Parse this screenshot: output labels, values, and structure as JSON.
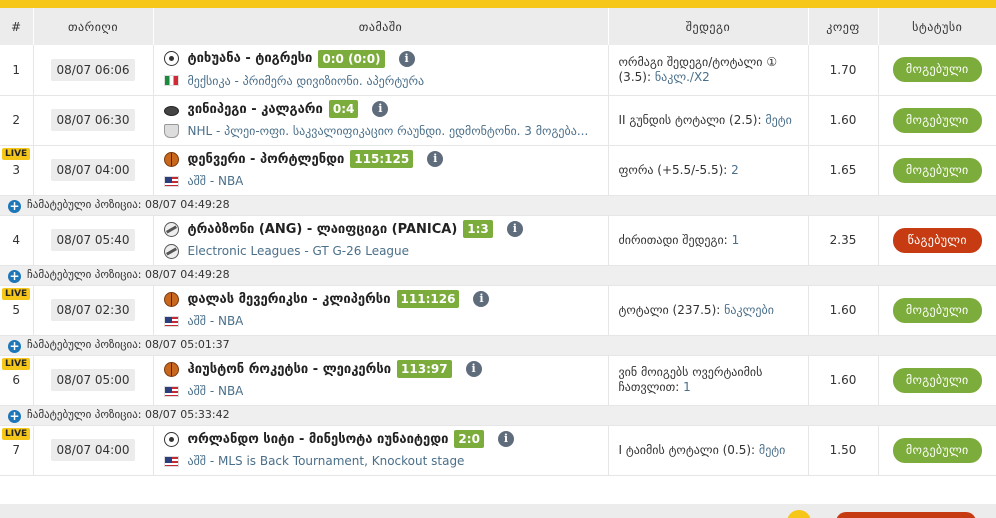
{
  "header": {
    "num": "#",
    "date": "თარიღი",
    "match": "თამაში",
    "result": "შედეგი",
    "odds": "კოეფ",
    "status": "სტატუსი"
  },
  "cashout_label": "ჩამატებული პოზიცია:",
  "colors": {
    "accent_yellow": "#f6c619",
    "won_green": "#7cac3b",
    "lost_red": "#c73b12",
    "league_blue": "#4a6f8a",
    "plus_blue": "#1d76b8"
  },
  "rows": [
    {
      "num": "1",
      "live": false,
      "date": "08/07 06:06",
      "sport_icon": "soccer-ball-icon",
      "teams": "ტიხუანა - ტიგრესი",
      "score": "0:0 (0:0)",
      "flag_icon": "mexico-flag-icon",
      "league": "მექსიკა - პრიმერა დივიზიონი. აპერტურა",
      "result_line1": "ორმაგი შედეგი/ტოტალი ① (3.5):",
      "result_pick": "ნაკლ./X2",
      "odds": "1.70",
      "status": "მოგებული",
      "status_type": "won"
    },
    {
      "num": "2",
      "live": false,
      "date": "08/07 06:30",
      "sport_icon": "hockey-puck-icon",
      "teams": "ვინიპეგი - კალგარი",
      "score": "0:4",
      "flag_icon": "nhl-logo-icon",
      "league": "NHL - პლეი-ოფი. საკვალიფიკაციო რაუნდი. ედმონტონი. 3 მოგება...",
      "result_line1": "II გუნდის ტოტალი (2.5):",
      "result_pick": "მეტი",
      "odds": "1.60",
      "status": "მოგებული",
      "status_type": "won"
    },
    {
      "num": "3",
      "live": true,
      "live_label": "LIVE",
      "date": "08/07 04:00",
      "sport_icon": "basketball-icon",
      "teams": "დენვერი - პორტლენდი",
      "score": "115:125",
      "flag_icon": "usa-flag-icon",
      "league": "აშშ - NBA",
      "result_line1": "ფორა (+5.5/-5.5):",
      "result_pick": "2",
      "odds": "1.65",
      "status": "მოგებული",
      "status_type": "won",
      "cashout_time": "08/07 04:49:28"
    },
    {
      "num": "4",
      "live": false,
      "date": "08/07 05:40",
      "sport_icon": "esports-icon",
      "teams": "ტრაბზონი (ANG) - ლაიფციგი (PANICA)",
      "score": "1:3",
      "flag_icon": "",
      "league": "Electronic Leagues - GT G-26 League",
      "result_line1": "ძირითადი შედეგი:",
      "result_pick": "1",
      "odds": "2.35",
      "status": "წაგებული",
      "status_type": "lost",
      "cashout_time": "08/07 04:49:28"
    },
    {
      "num": "5",
      "live": true,
      "live_label": "LIVE",
      "date": "08/07 02:30",
      "sport_icon": "basketball-icon",
      "teams": "დალას მევერიკსი - კლიპერსი",
      "score": "111:126",
      "flag_icon": "usa-flag-icon",
      "league": "აშშ - NBA",
      "result_line1": "ტოტალი (237.5):",
      "result_pick": "ნაკლები",
      "odds": "1.60",
      "status": "მოგებული",
      "status_type": "won",
      "cashout_time": "08/07 05:01:37"
    },
    {
      "num": "6",
      "live": true,
      "live_label": "LIVE",
      "date": "08/07 05:00",
      "sport_icon": "basketball-icon",
      "teams": "ჰიუსტონ როკეტსი - ლეიკერსი",
      "score": "113:97",
      "flag_icon": "usa-flag-icon",
      "league": "აშშ - NBA",
      "result_line1": "ვინ მოიგებს ოვერტაიმის ჩათვლით:",
      "result_pick": "1",
      "odds": "1.60",
      "status": "მოგებული",
      "status_type": "won",
      "cashout_time": "08/07 05:33:42"
    },
    {
      "num": "7",
      "live": true,
      "live_label": "LIVE",
      "date": "08/07 04:00",
      "sport_icon": "soccer-ball-icon",
      "teams": "ორლანდო სიტი - მინესოტა იუნაიტედი",
      "score": "2:0",
      "flag_icon": "usa-flag-icon",
      "league": "აშშ - MLS is Back Tournament, Knockout stage",
      "result_line1": "I ტაიმის ტოტალი (0.5):",
      "result_pick": "მეტი",
      "odds": "1.50",
      "status": "მოგებული",
      "status_type": "won"
    }
  ]
}
